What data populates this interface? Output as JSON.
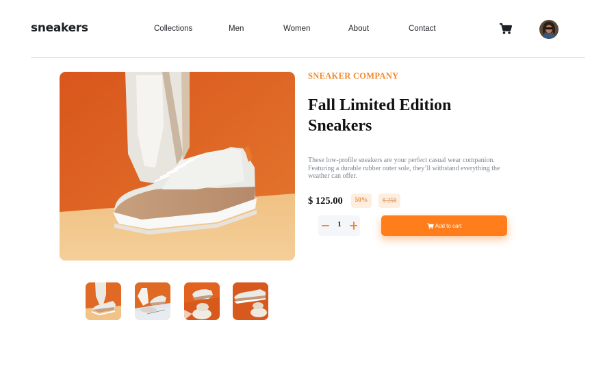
{
  "header": {
    "logo": "sneakers",
    "nav": [
      "Collections",
      "Men",
      "Women",
      "About",
      "Contact"
    ]
  },
  "product": {
    "company": "SNEAKER COMPANY",
    "title": "Fall Limited Edition Sneakers",
    "description": "These low-profile sneakers are your perfect casual wear companion. Featuring a durable rubber outer sole, they’ll withstand everything the weather can offer.",
    "price": "$ 125.00",
    "discount": "50%",
    "old_price": "$ 250"
  },
  "cart": {
    "quantity": "1",
    "add_label": "Add to cart"
  },
  "icons": [
    "cart-icon",
    "avatar",
    "minus-icon",
    "plus-icon"
  ],
  "colors": {
    "accent": "#ff7d1a",
    "accent_text": "#f18a2e",
    "accent_pale": "#fdeee0",
    "text_dark": "#1d2025",
    "text_muted": "#7d8491"
  }
}
